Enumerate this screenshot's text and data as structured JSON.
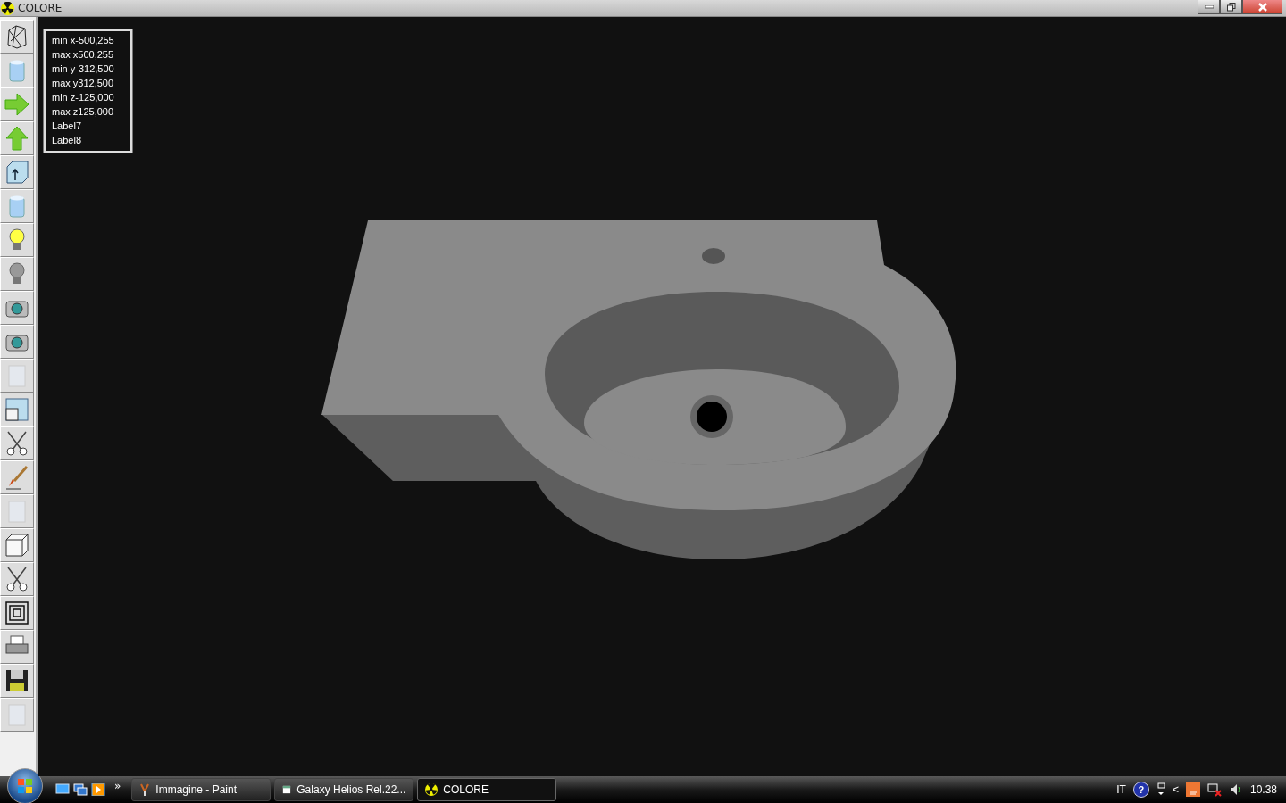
{
  "window": {
    "title": "COLORE"
  },
  "tools": [
    {
      "kind": "wireframe"
    },
    {
      "kind": "cylinder"
    },
    {
      "kind": "arrow-right"
    },
    {
      "kind": "arrow-up"
    },
    {
      "kind": "box-arrow"
    },
    {
      "kind": "cylinder"
    },
    {
      "kind": "bulb-on"
    },
    {
      "kind": "bulb-off"
    },
    {
      "kind": "camera"
    },
    {
      "kind": "camera"
    },
    {
      "kind": "texture"
    },
    {
      "kind": "window"
    },
    {
      "kind": "scissors"
    },
    {
      "kind": "brush"
    },
    {
      "kind": "texture"
    },
    {
      "kind": "cube"
    },
    {
      "kind": "scissors"
    },
    {
      "kind": "squares"
    },
    {
      "kind": "printer"
    },
    {
      "kind": "floppy"
    },
    {
      "kind": "texture"
    }
  ],
  "info_labels": [
    "min x-500,255",
    "max x500,255",
    "min y-312,500",
    "max y312,500",
    "min z-125,000",
    "max z125,000",
    "Label7",
    "Label8"
  ],
  "taskbar": {
    "overflow": "»",
    "tasks": [
      {
        "label": "Immagine - Paint",
        "kind": "paint",
        "selected": false
      },
      {
        "label": "Galaxy Helios  Rel.22...",
        "kind": "window",
        "selected": false
      },
      {
        "label": "COLORE",
        "kind": "radiation",
        "selected": true
      }
    ],
    "tray": {
      "language": "IT",
      "help": "?",
      "chevron": "<",
      "clock": "10.38"
    }
  }
}
